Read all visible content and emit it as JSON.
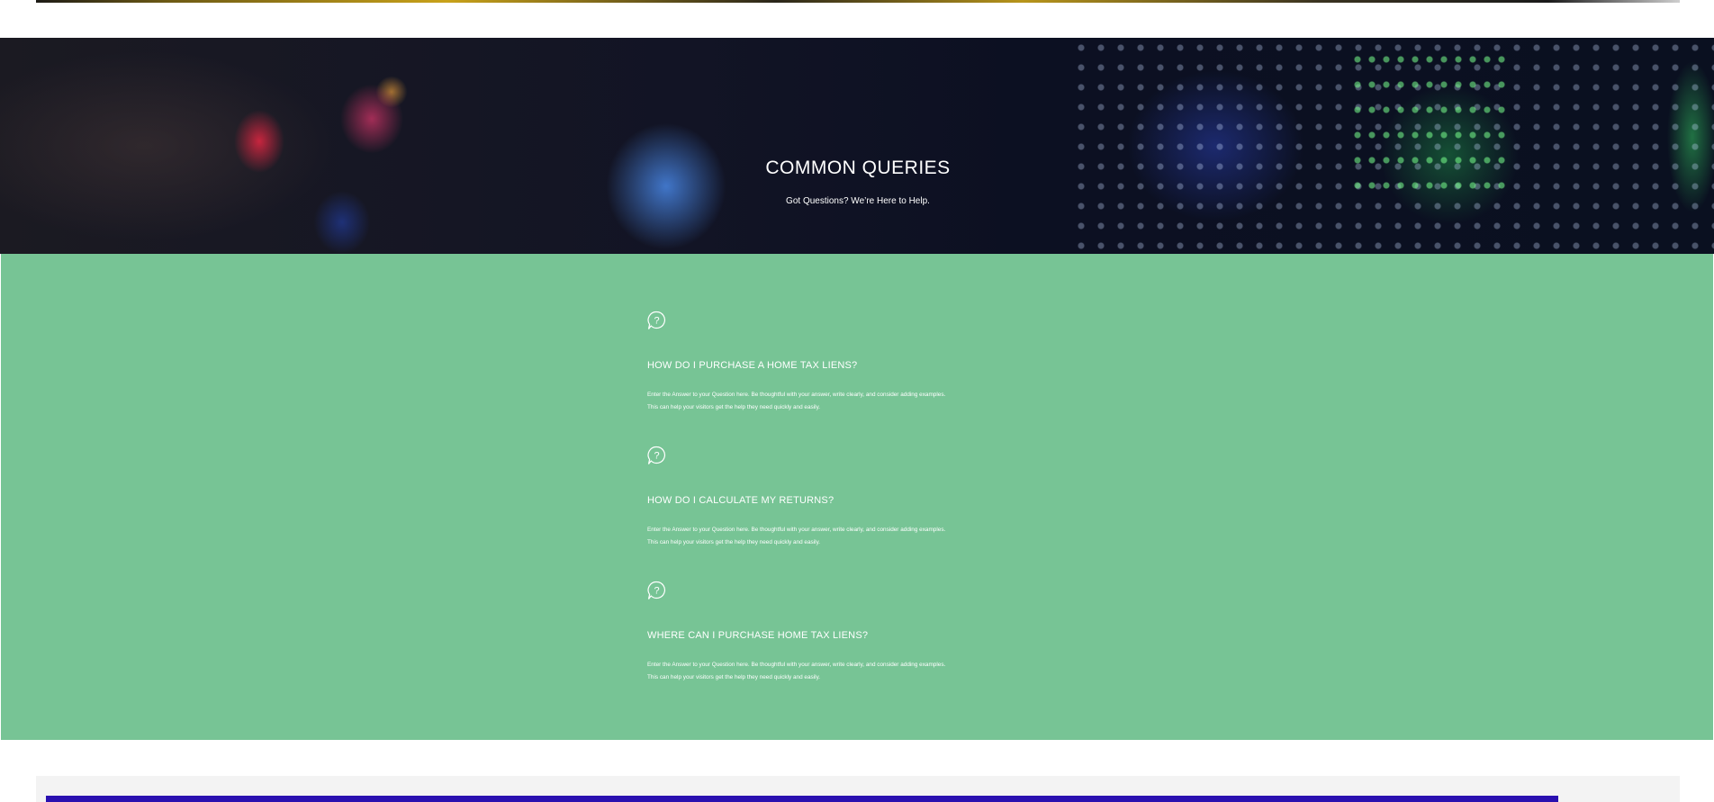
{
  "hero": {
    "title": "COMMON QUERIES",
    "subtitle": "Got Questions? We’re Here to Help."
  },
  "faq": {
    "icon": "question-bubble-icon",
    "items": [
      {
        "question": "HOW DO I PURCHASE A HOME TAX LIENS?",
        "answer_line1": "Enter the Answer to your Question here. Be thoughtful with your answer, write clearly, and consider adding examples.",
        "answer_line2": "This can help your visitors get the help they need quickly and easily."
      },
      {
        "question": "HOW DO I CALCULATE MY RETURNS?",
        "answer_line1": "Enter the Answer to your Question here. Be thoughtful with your answer, write clearly, and consider adding examples.",
        "answer_line2": "This can help your visitors get the help they need quickly and easily."
      },
      {
        "question": "WHERE CAN I PURCHASE HOME TAX LIENS?",
        "answer_line1": "Enter the Answer to your Question here. Be thoughtful with your answer, write clearly, and consider adding examples.",
        "answer_line2": "This can help your visitors get the help they need quickly and easily."
      }
    ]
  },
  "colors": {
    "faq_background": "#77c495",
    "hero_background": "#0c1020",
    "footer_bar": "#2a10b0"
  }
}
